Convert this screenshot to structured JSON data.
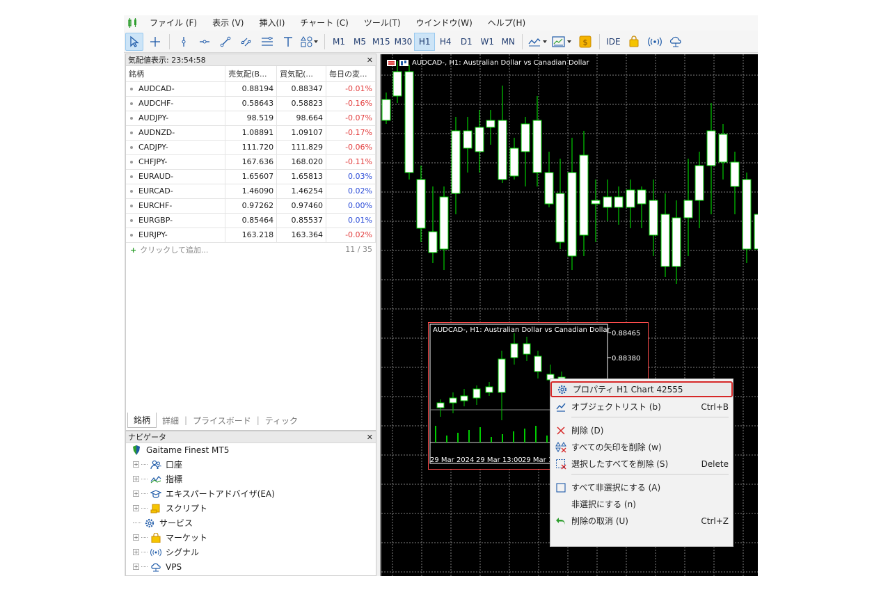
{
  "menubar": {
    "items": [
      "ファイル (F)",
      "表示 (V)",
      "挿入(I)",
      "チャート (C)",
      "ツール(T)",
      "ウインドウ(W)",
      "ヘルプ(H)"
    ]
  },
  "toolbar": {
    "timeframes": [
      "M1",
      "M5",
      "M15",
      "M30",
      "H1",
      "H4",
      "D1",
      "W1",
      "MN"
    ],
    "active_timeframe": "H1",
    "ide_label": "IDE"
  },
  "market_watch": {
    "title": "気配値表示: 23:54:58",
    "columns": [
      "銘柄",
      "売気配(B...",
      "買気配(...",
      "毎日の変..."
    ],
    "rows": [
      {
        "symbol": "AUDCAD-",
        "bid": "0.88194",
        "ask": "0.88347",
        "change": "-0.01%",
        "dir": "neg"
      },
      {
        "symbol": "AUDCHF-",
        "bid": "0.58643",
        "ask": "0.58823",
        "change": "-0.16%",
        "dir": "neg"
      },
      {
        "symbol": "AUDJPY-",
        "bid": "98.519",
        "ask": "98.664",
        "change": "-0.07%",
        "dir": "neg"
      },
      {
        "symbol": "AUDNZD-",
        "bid": "1.08891",
        "ask": "1.09107",
        "change": "-0.17%",
        "dir": "neg"
      },
      {
        "symbol": "CADJPY-",
        "bid": "111.720",
        "ask": "111.829",
        "change": "-0.06%",
        "dir": "neg"
      },
      {
        "symbol": "CHFJPY-",
        "bid": "167.636",
        "ask": "168.020",
        "change": "-0.11%",
        "dir": "neg"
      },
      {
        "symbol": "EURAUD-",
        "bid": "1.65607",
        "ask": "1.65813",
        "change": "0.03%",
        "dir": "pos"
      },
      {
        "symbol": "EURCAD-",
        "bid": "1.46090",
        "ask": "1.46254",
        "change": "0.02%",
        "dir": "pos"
      },
      {
        "symbol": "EURCHF-",
        "bid": "0.97262",
        "ask": "0.97460",
        "change": "0.00%",
        "dir": "pos"
      },
      {
        "symbol": "EURGBP-",
        "bid": "0.85464",
        "ask": "0.85537",
        "change": "0.01%",
        "dir": "pos"
      },
      {
        "symbol": "EURJPY-",
        "bid": "163.218",
        "ask": "163.364",
        "change": "-0.02%",
        "dir": "neg"
      }
    ],
    "add_label": "クリックして追加...",
    "count": "11 / 35",
    "tabs": [
      "銘柄",
      "詳細",
      "プライスボード",
      "ティック"
    ]
  },
  "navigator": {
    "title": "ナビゲータ",
    "root": "Gaitame Finest MT5",
    "items": [
      {
        "label": "口座",
        "icon": "accounts-icon"
      },
      {
        "label": "指標",
        "icon": "indicator-icon"
      },
      {
        "label": "エキスパートアドバイザ(EA)",
        "icon": "expert-advisor-icon"
      },
      {
        "label": "スクリプト",
        "icon": "script-icon"
      },
      {
        "label": "サービス",
        "icon": "service-gear-icon"
      },
      {
        "label": "マーケット",
        "icon": "market-bag-icon"
      },
      {
        "label": "シグナル",
        "icon": "signal-icon"
      },
      {
        "label": "VPS",
        "icon": "vps-cloud-icon"
      }
    ]
  },
  "chart": {
    "title": "AUDCAD-, H1:  Australian Dollar vs Canadian Dollar",
    "bull_color": "#ffffff",
    "wick_color": "#00cc00",
    "grid_color": "#7f7f7f"
  },
  "preview": {
    "title": "AUDCAD-, H1:  Australian Dollar vs Canadian Dollar",
    "price_labels": [
      "0.88465",
      "0.88380"
    ],
    "time_labels": [
      "29 Mar 2024",
      "29 Mar 13:00",
      "29 Mar 1"
    ]
  },
  "context_menu": {
    "items": [
      {
        "label": "プロパティ H1 Chart 42555",
        "shortcut": "",
        "icon": "properties-gear-icon",
        "highlighted": true
      },
      {
        "label": "オブジェクトリスト (b)",
        "shortcut": "Ctrl+B",
        "icon": "object-list-icon"
      },
      {
        "label": "削除 (D)",
        "shortcut": "",
        "icon": "delete-x-icon"
      },
      {
        "label": "すべての矢印を削除 (w)",
        "shortcut": "",
        "icon": "delete-arrows-icon"
      },
      {
        "label": "選択したすべてを削除 (S)",
        "shortcut": "Delete",
        "icon": "delete-selected-icon"
      },
      {
        "label": "すべて非選択にする (A)",
        "shortcut": "",
        "icon": "deselect-all-icon"
      },
      {
        "label": "非選択にする (n)",
        "shortcut": "",
        "icon": ""
      },
      {
        "label": "削除の取消 (U)",
        "shortcut": "Ctrl+Z",
        "icon": "undo-arrow-icon"
      }
    ]
  }
}
